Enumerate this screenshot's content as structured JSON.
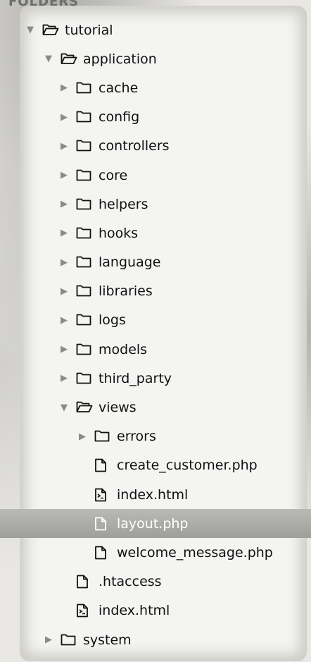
{
  "sidebar": {
    "header": "FOLDERS",
    "items": [
      {
        "label": "tutorial",
        "type": "folder-open",
        "depth": 0,
        "expanded": true
      },
      {
        "label": "application",
        "type": "folder-open",
        "depth": 1,
        "expanded": true
      },
      {
        "label": "cache",
        "type": "folder",
        "depth": 2
      },
      {
        "label": "config",
        "type": "folder",
        "depth": 2
      },
      {
        "label": "controllers",
        "type": "folder",
        "depth": 2
      },
      {
        "label": "core",
        "type": "folder",
        "depth": 2
      },
      {
        "label": "helpers",
        "type": "folder",
        "depth": 2
      },
      {
        "label": "hooks",
        "type": "folder",
        "depth": 2
      },
      {
        "label": "language",
        "type": "folder",
        "depth": 2
      },
      {
        "label": "libraries",
        "type": "folder",
        "depth": 2
      },
      {
        "label": "logs",
        "type": "folder",
        "depth": 2
      },
      {
        "label": "models",
        "type": "folder",
        "depth": 2
      },
      {
        "label": "third_party",
        "type": "folder",
        "depth": 2
      },
      {
        "label": "views",
        "type": "folder-open",
        "depth": 2,
        "expanded": true
      },
      {
        "label": "errors",
        "type": "folder",
        "depth": 3
      },
      {
        "label": "create_customer.php",
        "type": "file",
        "depth": 3
      },
      {
        "label": "index.html",
        "type": "file-html",
        "depth": 3
      },
      {
        "label": "layout.php",
        "type": "file",
        "depth": 3,
        "selected": true
      },
      {
        "label": "welcome_message.php",
        "type": "file",
        "depth": 3
      },
      {
        "label": ".htaccess",
        "type": "file",
        "depth": 2
      },
      {
        "label": "index.html",
        "type": "file-html",
        "depth": 2
      },
      {
        "label": "system",
        "type": "folder",
        "depth": 1
      }
    ]
  },
  "colors": {
    "selected_row": "#a9a9a6",
    "arrow": "#8a8a88",
    "text": "#111111",
    "header": "#6d6d6a"
  }
}
